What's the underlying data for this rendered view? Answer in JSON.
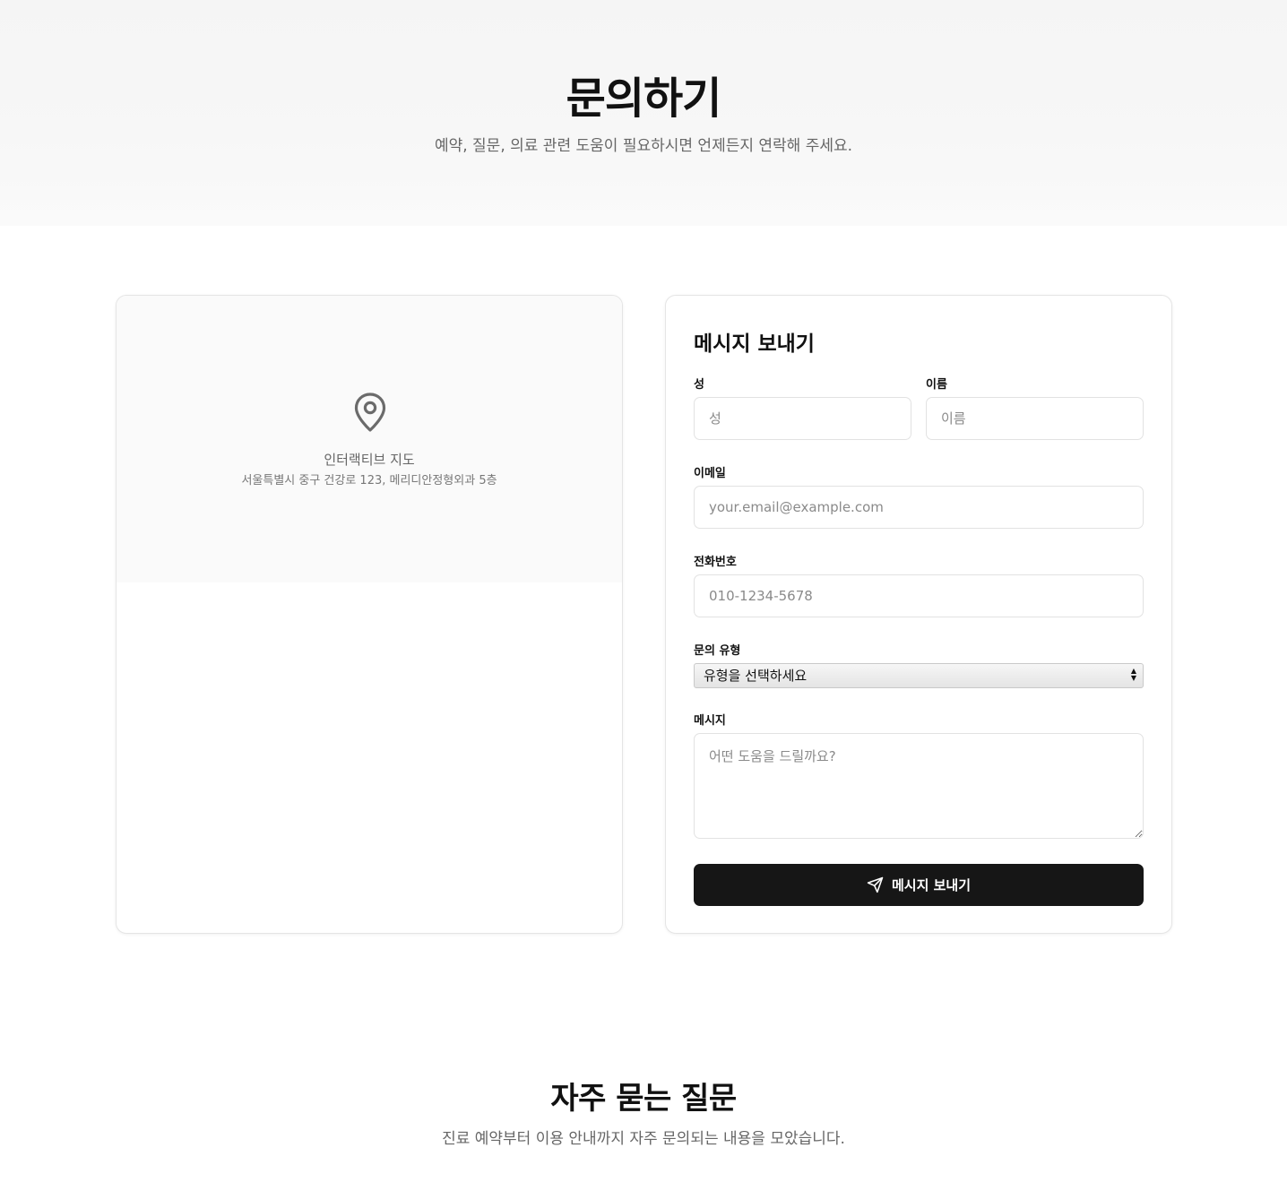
{
  "hero": {
    "title": "문의하기",
    "subtitle": "예약, 질문, 의료 관련 도움이 필요하시면 언제든지 연락해 주세요."
  },
  "map": {
    "icon": "map-pin-icon",
    "label": "인터랙티브 지도",
    "address": "서울특별시 중구 건강로 123, 메리디안정형외과 5층"
  },
  "form": {
    "title": "메시지 보내기",
    "last_name": {
      "label": "성",
      "placeholder": "성",
      "value": ""
    },
    "first_name": {
      "label": "이름",
      "placeholder": "이름",
      "value": ""
    },
    "email": {
      "label": "이메일",
      "placeholder": "your.email@example.com",
      "value": ""
    },
    "phone": {
      "label": "전화번호",
      "placeholder": "010-1234-5678",
      "value": ""
    },
    "inquiry_type": {
      "label": "문의 유형",
      "selected": "유형을 선택하세요"
    },
    "message": {
      "label": "메시지",
      "placeholder": "어떤 도움을 드릴까요?",
      "value": ""
    },
    "submit": {
      "label": "메시지 보내기",
      "icon": "send-icon"
    }
  },
  "faq": {
    "title": "자주 묻는 질문",
    "subtitle": "진료 예약부터 이용 안내까지 자주 문의되는 내용을 모았습니다."
  },
  "colors": {
    "primary_button": "#161616",
    "muted_text": "#666666",
    "border": "#e2e2e2"
  }
}
